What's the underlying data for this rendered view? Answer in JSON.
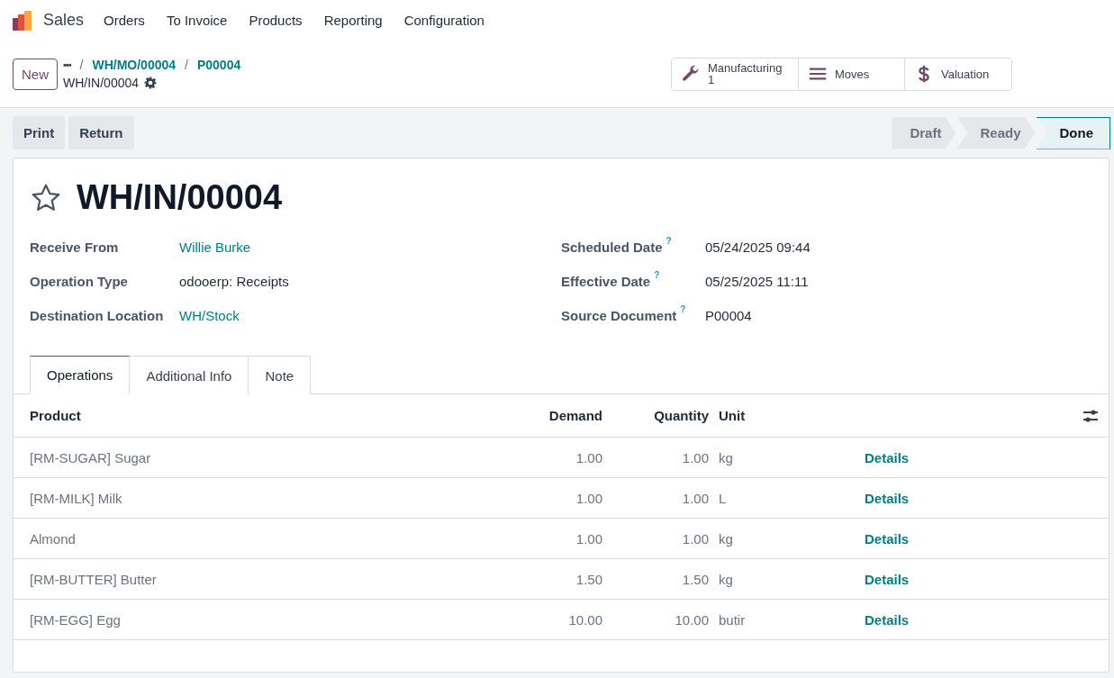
{
  "navbar": {
    "app": "Sales",
    "menu": [
      "Orders",
      "To Invoice",
      "Products",
      "Reporting",
      "Configuration"
    ]
  },
  "control_panel": {
    "new_button": "New",
    "breadcrumbs_more": "•••",
    "breadcrumb_separator": "/",
    "breadcrumbs": [
      "WH/MO/00004",
      "P00004"
    ],
    "current": "WH/IN/00004",
    "smart_buttons": [
      {
        "kind": "wrench",
        "label": "Manufacturing",
        "count": "1"
      },
      {
        "kind": "list",
        "label": "Moves"
      },
      {
        "kind": "dollar",
        "label": "Valuation"
      }
    ]
  },
  "actions": [
    "Print",
    "Return"
  ],
  "statusbar": [
    {
      "label": "Draft",
      "selected": false
    },
    {
      "label": "Ready",
      "selected": false
    },
    {
      "label": "Done",
      "selected": true
    }
  ],
  "form": {
    "title": "WH/IN/00004",
    "starred": false,
    "left_fields": [
      {
        "label": "Receive From",
        "value": "Willie Burke",
        "link": true
      },
      {
        "label": "Operation Type",
        "value": "odooerp: Receipts",
        "link": false
      },
      {
        "label": "Destination Location",
        "value": "WH/Stock",
        "link": true
      }
    ],
    "right_fields": [
      {
        "label": "Scheduled Date",
        "help": "?",
        "value": "05/24/2025 09:44"
      },
      {
        "label": "Effective Date",
        "help": "?",
        "value": "05/25/2025 11:11"
      },
      {
        "label": "Source Document",
        "help": "?",
        "value": "P00004"
      }
    ],
    "tabs": [
      {
        "label": "Operations",
        "selected": true
      },
      {
        "label": "Additional Info",
        "selected": false
      },
      {
        "label": "Note",
        "selected": false
      }
    ],
    "table": {
      "columns": [
        "Product",
        "Demand",
        "Quantity",
        "Unit"
      ],
      "rows": [
        {
          "product": "[RM-SUGAR] Sugar",
          "demand": "1.00",
          "quantity": "1.00",
          "unit": "kg",
          "action": "Details"
        },
        {
          "product": "[RM-MILK] Milk",
          "demand": "1.00",
          "quantity": "1.00",
          "unit": "L",
          "action": "Details"
        },
        {
          "product": "Almond",
          "demand": "1.00",
          "quantity": "1.00",
          "unit": "kg",
          "action": "Details"
        },
        {
          "product": "[RM-BUTTER] Butter",
          "demand": "1.50",
          "quantity": "1.50",
          "unit": "kg",
          "action": "Details"
        },
        {
          "product": "[RM-EGG] Egg",
          "demand": "10.00",
          "quantity": "10.00",
          "unit": "butir",
          "action": "Details"
        }
      ]
    }
  }
}
